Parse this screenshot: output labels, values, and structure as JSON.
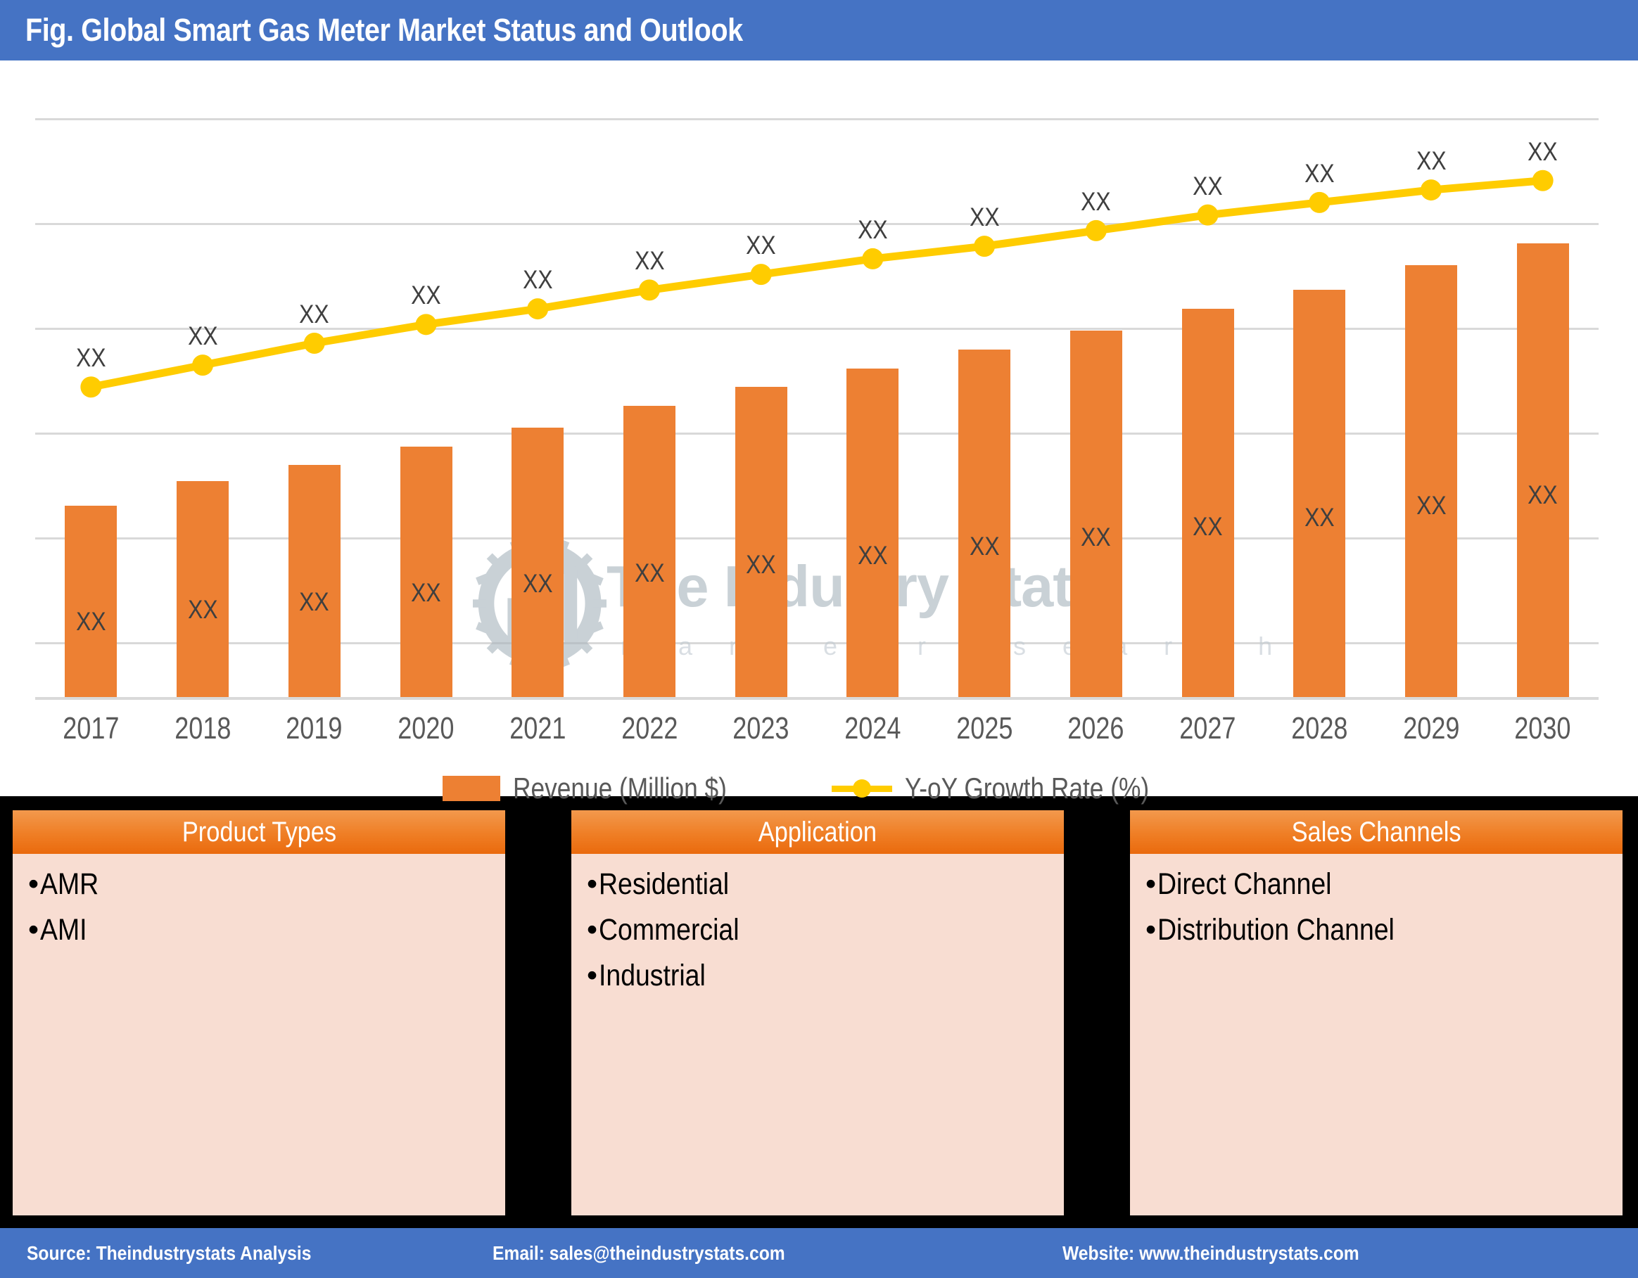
{
  "title": "Fig. Global Smart Gas Meter Market Status and Outlook",
  "watermark": {
    "brand": "The Industry Stats",
    "tagline": "m a r k e t    r e s e a r c h",
    "logo_icon": "gear-factory-wrench-icon"
  },
  "chart_data": {
    "type": "bar",
    "title": "Fig. Global Smart Gas Meter Market Status and Outlook",
    "xlabel": "",
    "ylabel": "",
    "grid": true,
    "legend_position": "bottom",
    "gridline_count": 6,
    "categories": [
      "2017",
      "2018",
      "2019",
      "2020",
      "2021",
      "2022",
      "2023",
      "2024",
      "2025",
      "2026",
      "2027",
      "2028",
      "2029",
      "2030"
    ],
    "series": [
      {
        "name": "Revenue (Million $)",
        "type": "bar",
        "color": "#ED8033",
        "values": [
          62,
          70,
          75,
          81,
          87,
          94,
          100,
          106,
          112,
          118,
          125,
          131,
          139,
          146
        ],
        "value_labels": [
          "XX",
          "XX",
          "XX",
          "XX",
          "XX",
          "XX",
          "XX",
          "XX",
          "XX",
          "XX",
          "XX",
          "XX",
          "XX",
          "XX"
        ],
        "label_position": "inside-center"
      },
      {
        "name": "Y-oY Growth Rate (%)",
        "type": "line",
        "color": "#FFCC00",
        "marker": "circle",
        "values": [
          100,
          107,
          114,
          120,
          125,
          131,
          136,
          141,
          145,
          150,
          155,
          159,
          163,
          166
        ],
        "value_labels": [
          "XX",
          "XX",
          "XX",
          "XX",
          "XX",
          "XX",
          "XX",
          "XX",
          "XX",
          "XX",
          "XX",
          "XX",
          "XX",
          "XX"
        ],
        "label_position": "above-point"
      }
    ]
  },
  "legend": [
    {
      "label": "Revenue (Million $)",
      "swatch": "bar",
      "color": "#ED8033"
    },
    {
      "label": "Y-oY Growth Rate (%)",
      "swatch": "line-marker",
      "color": "#FFCC00"
    }
  ],
  "categories_panel": [
    {
      "heading": "Product Types",
      "items": [
        "AMR",
        "AMI"
      ]
    },
    {
      "heading": "Application",
      "items": [
        "Residential",
        "Commercial",
        "Industrial"
      ]
    },
    {
      "heading": "Sales Channels",
      "items": [
        "Direct Channel",
        "Distribution Channel"
      ]
    }
  ],
  "footer": {
    "source": "Source: Theindustrystats Analysis",
    "email": "Email: sales@theindustrystats.com",
    "website": "Website: www.theindustrystats.com"
  },
  "colors": {
    "header_blue": "#4573C4",
    "bar_orange": "#ED8033",
    "line_yellow": "#FFCC00",
    "box_fill": "#F8DDD2",
    "box_head": "#EF7E25",
    "grid_gray": "#D9D9D9",
    "panel_black": "#000000"
  }
}
